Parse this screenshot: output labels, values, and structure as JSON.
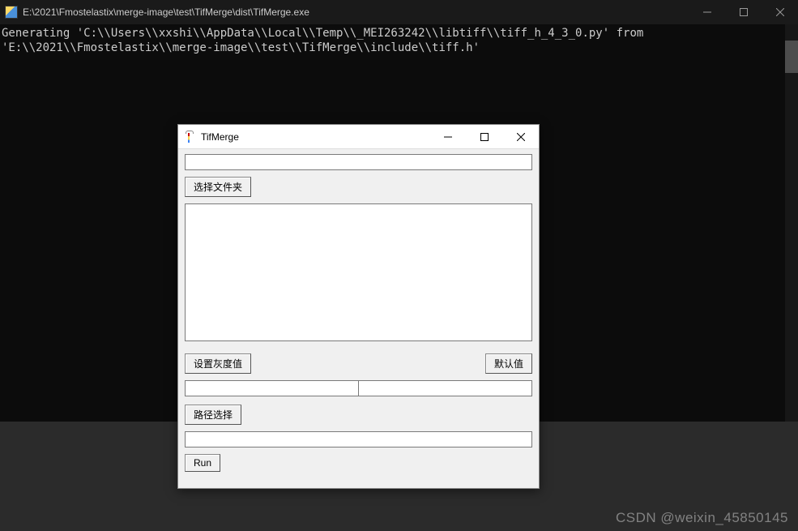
{
  "console": {
    "title": "E:\\2021\\Fmostelastix\\merge-image\\test\\TifMerge\\dist\\TifMerge.exe",
    "output": "Generating 'C:\\\\Users\\\\xxshi\\\\AppData\\\\Local\\\\Temp\\\\_MEI263242\\\\libtiff\\\\tiff_h_4_3_0.py' from 'E:\\\\2021\\\\Fmostelastix\\\\merge-image\\\\test\\\\TifMerge\\\\include\\\\tiff.h'"
  },
  "dialog": {
    "title": "TifMerge",
    "input1_value": "",
    "select_folder_label": "选择文件夹",
    "textarea_value": "",
    "set_gray_label": "设置灰度值",
    "default_label": "默认值",
    "gray_left_value": "",
    "gray_right_value": "",
    "path_select_label": "路径选择",
    "path_value": "",
    "run_label": "Run"
  },
  "watermark": "CSDN @weixin_45850145"
}
